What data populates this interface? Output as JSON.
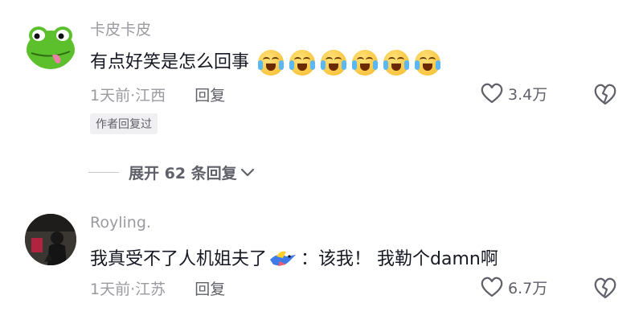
{
  "comments": [
    {
      "username": "卡皮卡皮",
      "text": "有点好笑是怎么回事",
      "emoji_name": "laughing-crying-emoji",
      "emoji_count": 6,
      "time": "1天前",
      "separator": "·",
      "location": "江西",
      "reply_label": "回复",
      "likes": "3.4万",
      "author_tag": "作者回复过"
    },
    {
      "username": "Royling.",
      "text_before": "我真受不了人机姐夫了",
      "sticker_name": "flying-bird-sticker",
      "text_after": "：该我！ 我勒个damn啊",
      "time": "1天前",
      "separator": "·",
      "location": "江苏",
      "reply_label": "回复",
      "likes": "6.7万"
    }
  ],
  "expand_replies": {
    "label": "展开 62 条回复"
  },
  "colors": {
    "primary_text": "#161823",
    "secondary_text": "#9a9ba1",
    "frog_green": "#5cc02c"
  },
  "icons": [
    "heart-outline-icon",
    "broken-heart-icon",
    "chevron-down-icon"
  ]
}
